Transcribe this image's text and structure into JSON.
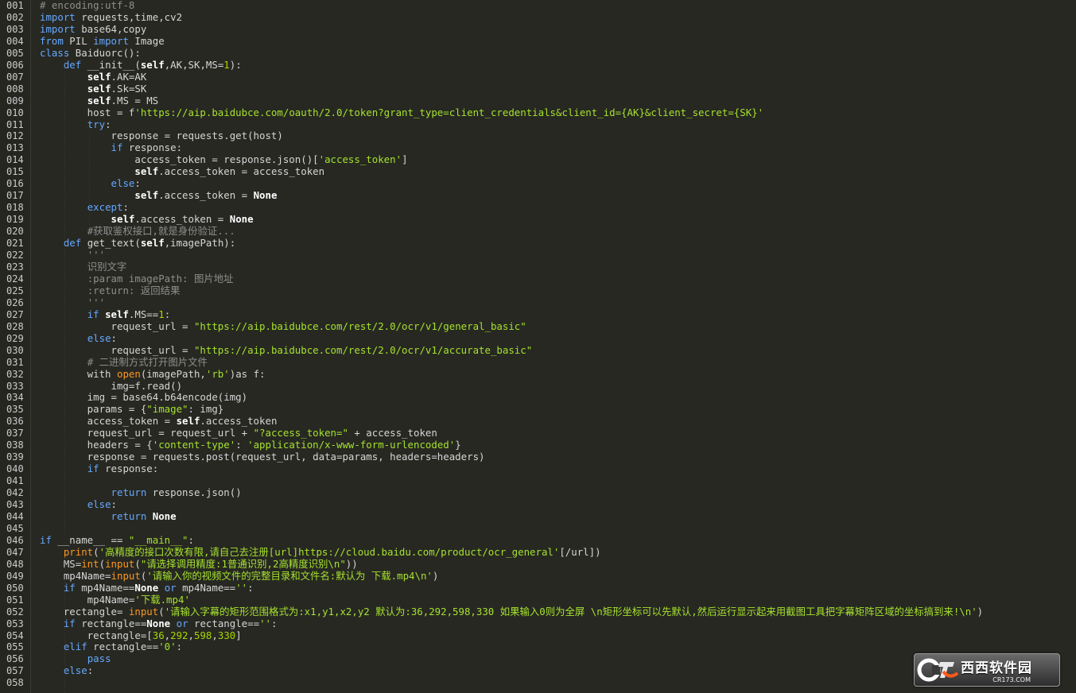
{
  "editor": {
    "line_numbers": [
      "001",
      "002",
      "003",
      "004",
      "005",
      "006",
      "007",
      "008",
      "009",
      "010",
      "011",
      "012",
      "013",
      "014",
      "015",
      "016",
      "017",
      "018",
      "019",
      "020",
      "021",
      "022",
      "023",
      "024",
      "025",
      "026",
      "027",
      "028",
      "029",
      "030",
      "031",
      "032",
      "033",
      "034",
      "035",
      "036",
      "037",
      "038",
      "039",
      "040",
      "041",
      "042",
      "043",
      "044",
      "045",
      "046",
      "047",
      "048",
      "049",
      "050",
      "051",
      "052",
      "053",
      "054",
      "055",
      "056",
      "057",
      "058"
    ],
    "lines": [
      [
        [
          "c",
          "# encoding:utf-8"
        ]
      ],
      [
        [
          "k",
          "import"
        ],
        [
          "t",
          " requests,time,cv2"
        ]
      ],
      [
        [
          "k",
          "import"
        ],
        [
          "t",
          " base64,copy"
        ]
      ],
      [
        [
          "k",
          "from"
        ],
        [
          "t",
          " PIL "
        ],
        [
          "k",
          "import"
        ],
        [
          "t",
          " Image"
        ]
      ],
      [
        [
          "k",
          "class"
        ],
        [
          "t",
          " Baiduorc():"
        ]
      ],
      [
        [
          "t",
          "    "
        ],
        [
          "k",
          "def"
        ],
        [
          "t",
          " __init__("
        ],
        [
          "b",
          "self"
        ],
        [
          "t",
          ",AK,SK,MS="
        ],
        [
          "n",
          "1"
        ],
        [
          "t",
          "):"
        ]
      ],
      [
        [
          "t",
          "        "
        ],
        [
          "b",
          "self"
        ],
        [
          "t",
          ".AK=AK"
        ]
      ],
      [
        [
          "t",
          "        "
        ],
        [
          "b",
          "self"
        ],
        [
          "t",
          ".Sk=SK"
        ]
      ],
      [
        [
          "t",
          "        "
        ],
        [
          "b",
          "self"
        ],
        [
          "t",
          ".MS = MS"
        ]
      ],
      [
        [
          "t",
          "        host = f"
        ],
        [
          "s",
          "'https://aip.baidubce.com/oauth/2.0/token?grant_type=client_credentials&client_id={AK}&client_secret={SK}'"
        ]
      ],
      [
        [
          "t",
          "        "
        ],
        [
          "k",
          "try"
        ],
        [
          "t",
          ":"
        ]
      ],
      [
        [
          "t",
          "            response = requests.get(host)"
        ]
      ],
      [
        [
          "t",
          "            "
        ],
        [
          "k",
          "if"
        ],
        [
          "t",
          " response:"
        ]
      ],
      [
        [
          "t",
          "                access_token = response.json()["
        ],
        [
          "s",
          "'access_token'"
        ],
        [
          "t",
          "]"
        ]
      ],
      [
        [
          "t",
          "                "
        ],
        [
          "b",
          "self"
        ],
        [
          "t",
          ".access_token = access_token"
        ]
      ],
      [
        [
          "t",
          "            "
        ],
        [
          "k",
          "else"
        ],
        [
          "t",
          ":"
        ]
      ],
      [
        [
          "t",
          "                "
        ],
        [
          "b",
          "self"
        ],
        [
          "t",
          ".access_token = "
        ],
        [
          "b",
          "None"
        ]
      ],
      [
        [
          "t",
          "        "
        ],
        [
          "k",
          "except"
        ],
        [
          "t",
          ":"
        ]
      ],
      [
        [
          "t",
          "            "
        ],
        [
          "b",
          "self"
        ],
        [
          "t",
          ".access_token = "
        ],
        [
          "b",
          "None"
        ]
      ],
      [
        [
          "t",
          "        "
        ],
        [
          "c",
          "#获取鉴权接口,就是身份验证..."
        ]
      ],
      [
        [
          "t",
          "    "
        ],
        [
          "k",
          "def"
        ],
        [
          "t",
          " get_text("
        ],
        [
          "b",
          "self"
        ],
        [
          "t",
          ",imagePath):"
        ]
      ],
      [
        [
          "t",
          "        "
        ],
        [
          "c",
          "'''"
        ]
      ],
      [
        [
          "t",
          "        "
        ],
        [
          "c",
          "识别文字"
        ]
      ],
      [
        [
          "t",
          "        "
        ],
        [
          "c",
          ":param imagePath: 图片地址"
        ]
      ],
      [
        [
          "t",
          "        "
        ],
        [
          "c",
          ":return: 返回结果"
        ]
      ],
      [
        [
          "t",
          "        "
        ],
        [
          "c",
          "'''"
        ]
      ],
      [
        [
          "t",
          "        "
        ],
        [
          "k",
          "if"
        ],
        [
          "t",
          " "
        ],
        [
          "b",
          "self"
        ],
        [
          "t",
          ".MS=="
        ],
        [
          "n",
          "1"
        ],
        [
          "t",
          ":"
        ]
      ],
      [
        [
          "t",
          "            request_url = "
        ],
        [
          "s",
          "\"https://aip.baidubce.com/rest/2.0/ocr/v1/general_basic\""
        ]
      ],
      [
        [
          "t",
          "        "
        ],
        [
          "k",
          "else"
        ],
        [
          "t",
          ":"
        ]
      ],
      [
        [
          "t",
          "            request_url = "
        ],
        [
          "s",
          "\"https://aip.baidubce.com/rest/2.0/ocr/v1/accurate_basic\""
        ]
      ],
      [
        [
          "t",
          "        "
        ],
        [
          "c",
          "# 二进制方式打开图片文件"
        ]
      ],
      [
        [
          "t",
          "        with "
        ],
        [
          "f",
          "open"
        ],
        [
          "t",
          "(imagePath,"
        ],
        [
          "s",
          "'rb'"
        ],
        [
          "t",
          ")as f:"
        ]
      ],
      [
        [
          "t",
          "            img=f.read()"
        ]
      ],
      [
        [
          "t",
          "        img = base64.b64encode(img)"
        ]
      ],
      [
        [
          "t",
          "        params = {"
        ],
        [
          "s",
          "\"image\""
        ],
        [
          "t",
          ": img}"
        ]
      ],
      [
        [
          "t",
          "        access_token = "
        ],
        [
          "b",
          "self"
        ],
        [
          "t",
          ".access_token"
        ]
      ],
      [
        [
          "t",
          "        request_url = request_url + "
        ],
        [
          "s",
          "\"?access_token=\""
        ],
        [
          "t",
          " + access_token"
        ]
      ],
      [
        [
          "t",
          "        headers = {"
        ],
        [
          "s",
          "'content-type'"
        ],
        [
          "t",
          ": "
        ],
        [
          "s",
          "'application/x-www-form-urlencoded'"
        ],
        [
          "t",
          "}"
        ]
      ],
      [
        [
          "t",
          "        response = requests.post(request_url, data=params, headers=headers)"
        ]
      ],
      [
        [
          "t",
          "        "
        ],
        [
          "k",
          "if"
        ],
        [
          "t",
          " response:"
        ]
      ],
      [
        [
          "t",
          ""
        ]
      ],
      [
        [
          "t",
          "            "
        ],
        [
          "k",
          "return"
        ],
        [
          "t",
          " response.json()"
        ]
      ],
      [
        [
          "t",
          "        "
        ],
        [
          "k",
          "else"
        ],
        [
          "t",
          ":"
        ]
      ],
      [
        [
          "t",
          "            "
        ],
        [
          "k",
          "return"
        ],
        [
          "t",
          " "
        ],
        [
          "b",
          "None"
        ]
      ],
      [
        [
          "t",
          ""
        ]
      ],
      [
        [
          "k",
          "if"
        ],
        [
          "t",
          " __name__ == "
        ],
        [
          "s",
          "\"__main__\""
        ],
        [
          "t",
          ":"
        ]
      ],
      [
        [
          "t",
          "    "
        ],
        [
          "f",
          "print"
        ],
        [
          "t",
          "("
        ],
        [
          "s",
          "'高精度的接口次数有限,请自己去注册[url]https://cloud.baidu.com/product/ocr_general'"
        ],
        [
          "t",
          "[/url])"
        ]
      ],
      [
        [
          "t",
          "    MS="
        ],
        [
          "f",
          "int"
        ],
        [
          "t",
          "("
        ],
        [
          "f",
          "input"
        ],
        [
          "t",
          "("
        ],
        [
          "s",
          "\"请选择调用精度:1普通识别,2高精度识别\\n\""
        ],
        [
          "t",
          "))"
        ]
      ],
      [
        [
          "t",
          "    mp4Name="
        ],
        [
          "f",
          "input"
        ],
        [
          "t",
          "("
        ],
        [
          "s",
          "'请输入你的视频文件的完整目录和文件名:默认为 下载.mp4\\n'"
        ],
        [
          "t",
          ")"
        ]
      ],
      [
        [
          "t",
          "    "
        ],
        [
          "k",
          "if"
        ],
        [
          "t",
          " mp4Name=="
        ],
        [
          "b",
          "None"
        ],
        [
          "t",
          " "
        ],
        [
          "k",
          "or"
        ],
        [
          "t",
          " mp4Name=="
        ],
        [
          "s",
          "''"
        ],
        [
          "t",
          ":"
        ]
      ],
      [
        [
          "t",
          "        mp4Name="
        ],
        [
          "s",
          "'下载.mp4'"
        ]
      ],
      [
        [
          "t",
          "    rectangle= "
        ],
        [
          "f",
          "input"
        ],
        [
          "t",
          "("
        ],
        [
          "s",
          "'请输入字幕的矩形范围格式为:x1,y1,x2,y2 默认为:36,292,598,330 如果输入0则为全屏 \\n矩形坐标可以先默认,然后运行显示起来用截图工具把字幕矩阵区域的坐标搞到来!\\n'"
        ],
        [
          "t",
          ")"
        ]
      ],
      [
        [
          "t",
          "    "
        ],
        [
          "k",
          "if"
        ],
        [
          "t",
          " rectangle=="
        ],
        [
          "b",
          "None"
        ],
        [
          "t",
          " "
        ],
        [
          "k",
          "or"
        ],
        [
          "t",
          " rectangle=="
        ],
        [
          "s",
          "''"
        ],
        [
          "t",
          ":"
        ]
      ],
      [
        [
          "t",
          "        rectangle=["
        ],
        [
          "n",
          "36"
        ],
        [
          "t",
          ","
        ],
        [
          "n",
          "292"
        ],
        [
          "t",
          ","
        ],
        [
          "n",
          "598"
        ],
        [
          "t",
          ","
        ],
        [
          "n",
          "330"
        ],
        [
          "t",
          "]"
        ]
      ],
      [
        [
          "k",
          "    elif"
        ],
        [
          "t",
          " rectangle=="
        ],
        [
          "s",
          "'0'"
        ],
        [
          "t",
          ":"
        ]
      ],
      [
        [
          "t",
          "        "
        ],
        [
          "k",
          "pass"
        ]
      ],
      [
        [
          "t",
          "    "
        ],
        [
          "k",
          "else"
        ],
        [
          "t",
          ":"
        ]
      ]
    ]
  },
  "watermark": {
    "title": "西西软件园",
    "subtitle": "CR173.COM"
  },
  "colors": {
    "background": "#272822",
    "keyword": "#66a8ff",
    "string": "#a6e22e",
    "comment": "#8e8e8e"
  }
}
